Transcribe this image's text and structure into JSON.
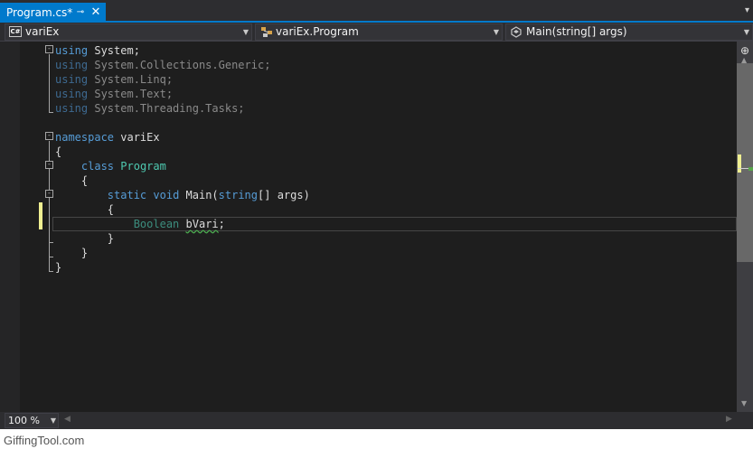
{
  "tab": {
    "title": "Program.cs*",
    "pin_icon": "pin-icon",
    "close_icon": "close-icon",
    "pin_glyph": "⊸",
    "close_glyph": "✕",
    "overflow_glyph": "▾"
  },
  "navbar": {
    "project": {
      "label": "variEx",
      "icon_text": "C#"
    },
    "type": {
      "label": "variEx.Program",
      "icon": "class-icon"
    },
    "member": {
      "label": "Main(string[] args)",
      "icon": "method-icon"
    },
    "arrow_glyph": "▼"
  },
  "code": [
    [
      {
        "t": "using",
        "c": "kw"
      },
      {
        "t": " System;",
        "c": "plain"
      }
    ],
    [
      {
        "t": "using",
        "c": "kw-dim"
      },
      {
        "t": " System.Collections.Generic;",
        "c": "ns-dim"
      }
    ],
    [
      {
        "t": "using",
        "c": "kw-dim"
      },
      {
        "t": " System.Linq;",
        "c": "ns-dim"
      }
    ],
    [
      {
        "t": "using",
        "c": "kw-dim"
      },
      {
        "t": " System.Text;",
        "c": "ns-dim"
      }
    ],
    [
      {
        "t": "using",
        "c": "kw-dim"
      },
      {
        "t": " System.Threading.Tasks;",
        "c": "ns-dim"
      }
    ],
    [],
    [
      {
        "t": "namespace",
        "c": "kw"
      },
      {
        "t": " variEx",
        "c": "plain"
      }
    ],
    [
      {
        "t": "{",
        "c": "plain"
      }
    ],
    [
      {
        "t": "    ",
        "c": "plain"
      },
      {
        "t": "class",
        "c": "kw"
      },
      {
        "t": " ",
        "c": "plain"
      },
      {
        "t": "Program",
        "c": "type"
      }
    ],
    [
      {
        "t": "    {",
        "c": "plain"
      }
    ],
    [
      {
        "t": "        ",
        "c": "plain"
      },
      {
        "t": "static",
        "c": "kw"
      },
      {
        "t": " ",
        "c": "plain"
      },
      {
        "t": "void",
        "c": "kw"
      },
      {
        "t": " Main(",
        "c": "plain"
      },
      {
        "t": "string",
        "c": "kw"
      },
      {
        "t": "[] args)",
        "c": "plain"
      }
    ],
    [
      {
        "t": "        {",
        "c": "plain"
      }
    ],
    [
      {
        "t": "            ",
        "c": "plain"
      },
      {
        "t": "Boolean",
        "c": "type-dim"
      },
      {
        "t": " ",
        "c": "plain"
      },
      {
        "t": "bVari",
        "c": "plain squiggle"
      },
      {
        "t": ";",
        "c": "plain"
      }
    ],
    [
      {
        "t": "        }",
        "c": "plain"
      }
    ],
    [
      {
        "t": "    }",
        "c": "plain"
      }
    ],
    [
      {
        "t": "}",
        "c": "plain"
      }
    ]
  ],
  "scrollbar": {
    "split_glyph": "⊕",
    "up_glyph": "▲",
    "down_glyph": "▼",
    "marker_colors": {
      "change": "#efef91",
      "ok": "#57a64a"
    }
  },
  "bottom": {
    "zoom": "100 %",
    "arrow_glyph": "▼",
    "left_glyph": "◀",
    "right_glyph": "▶"
  },
  "watermark": "GiffingTool.com",
  "colors": {
    "accent": "#007acc",
    "editor_bg": "#1e1e1e",
    "keyword": "#569cd6",
    "type": "#4ec9b0"
  }
}
